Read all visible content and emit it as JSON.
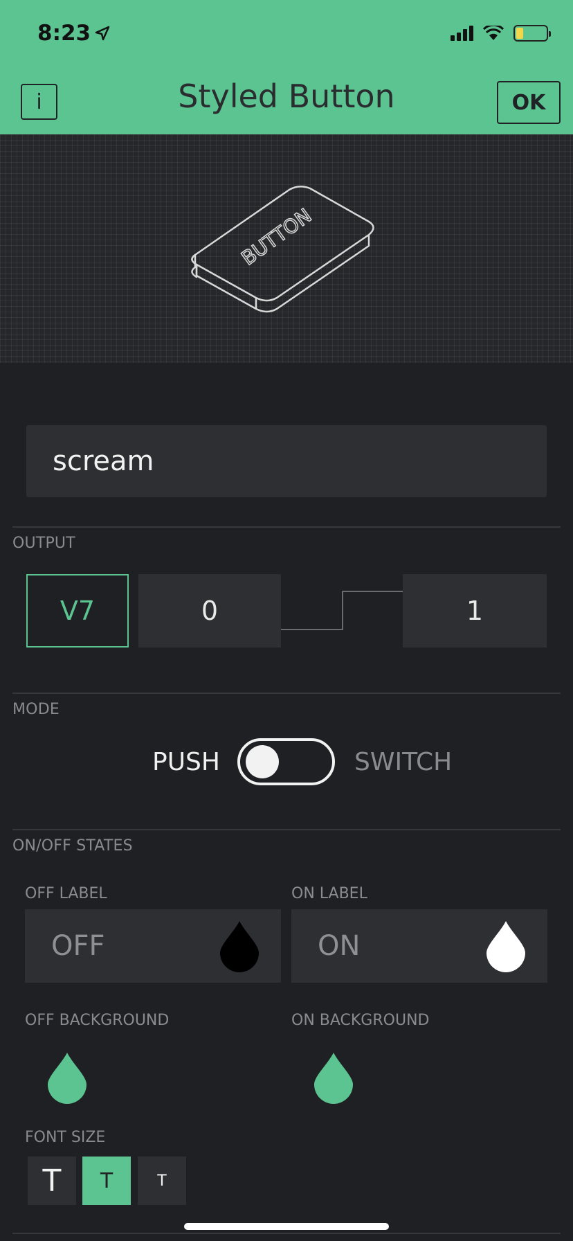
{
  "status_bar": {
    "time": "8:23"
  },
  "header": {
    "info_label": "i",
    "title": "Styled Button",
    "ok_label": "OK"
  },
  "preview": {
    "button_text": "BUTTON"
  },
  "name_field": {
    "value": "scream"
  },
  "output": {
    "section_label": "OUTPUT",
    "pin": "V7",
    "low_value": "0",
    "high_value": "1"
  },
  "mode": {
    "section_label": "MODE",
    "push_label": "PUSH",
    "switch_label": "SWITCH",
    "selected": "PUSH"
  },
  "states": {
    "section_label": "ON/OFF STATES",
    "off_label_title": "OFF LABEL",
    "off_label_value": "OFF",
    "on_label_title": "ON LABEL",
    "on_label_value": "ON",
    "off_background_title": "OFF BACKGROUND",
    "on_background_title": "ON BACKGROUND",
    "off_label_color": "#000000",
    "on_label_color": "#ffffff",
    "off_background_color": "#5cc491",
    "on_background_color": "#5cc491"
  },
  "font_size": {
    "section_label": "FONT SIZE",
    "options": [
      "T",
      "T",
      "T"
    ],
    "selected_index": 1
  },
  "colors": {
    "accent": "#5cc491",
    "background": "#1f2023",
    "field": "#2e2f33"
  }
}
